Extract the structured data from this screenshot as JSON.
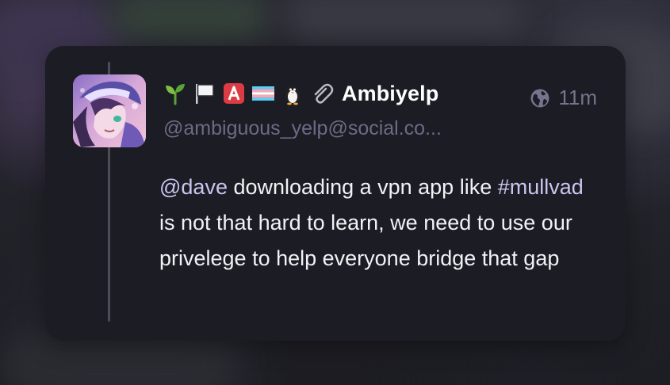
{
  "post": {
    "display_name": "Ambiyelp",
    "handle": "@ambiguous_yelp@social.co...",
    "timestamp": "11m",
    "visibility_icon": "globe-icon",
    "name_emojis": [
      "seedling-icon",
      "white-flag-icon",
      "a-button-icon",
      "trans-flag-icon",
      "penguin-icon",
      "paperclip-icon"
    ],
    "content": {
      "mention": "@dave",
      "text_1": " downloading a vpn app like ",
      "hashtag": "#mullvad",
      "text_2": " is not that hard to learn, we need to use our privelege to help everyone bridge that gap"
    }
  },
  "colors": {
    "card_bg": "#1c1c24",
    "name": "#ffffff",
    "handle": "#6b6b86",
    "link": "#c7c6f0",
    "body": "#f2f2f6"
  }
}
